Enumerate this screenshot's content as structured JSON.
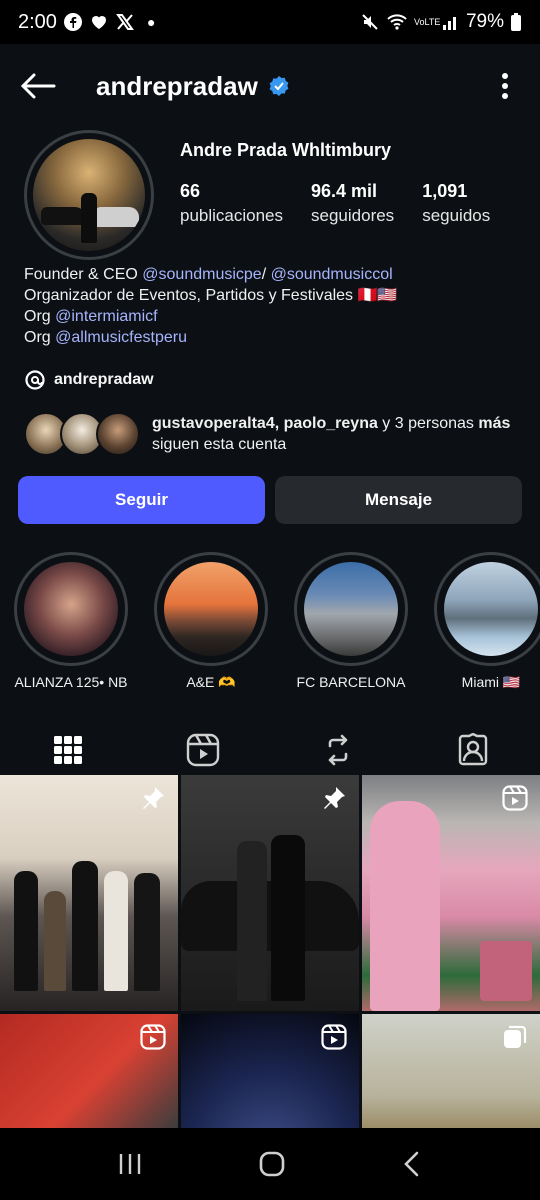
{
  "status_bar": {
    "time": "2:00",
    "battery": "79%",
    "network": "VoLTE"
  },
  "header": {
    "username": "andrepradaw",
    "verified": true
  },
  "profile": {
    "full_name": "Andre Prada Whltimbury",
    "stats": [
      {
        "value": "66",
        "label": "publicaciones"
      },
      {
        "value": "96.4 mil",
        "label": "seguidores"
      },
      {
        "value": "1,091",
        "label": "seguidos"
      }
    ],
    "bio": {
      "line1_prefix": "Founder & CEO ",
      "line1_mention1": "@soundmusicpe",
      "line1_sep": "/ ",
      "line1_mention2": "@soundmusiccol",
      "line2": "Organizador de Eventos, Partidos y Festivales 🇵🇪🇺🇸",
      "line3_prefix": "Org ",
      "line3_mention": "@intermiamicf",
      "line4_prefix": "Org ",
      "line4_mention": "@allmusicfestperu"
    },
    "threads_handle": "andrepradaw",
    "followed_by": {
      "names": "gustavoperalta4, paolo_reyna",
      "middle": " y 3 personas ",
      "more": "más",
      "suffix": " siguen esta cuenta"
    }
  },
  "actions": {
    "follow_label": "Seguir",
    "message_label": "Mensaje"
  },
  "highlights": [
    {
      "label": "ALIANZA 125• NB"
    },
    {
      "label": "A&E 🫶"
    },
    {
      "label": "FC BARCELONA"
    },
    {
      "label": "Miami 🇺🇸"
    }
  ],
  "tabs": [
    {
      "icon": "grid-icon",
      "active": true
    },
    {
      "icon": "reels-icon",
      "active": false
    },
    {
      "icon": "reposts-icon",
      "active": false
    },
    {
      "icon": "tagged-icon",
      "active": false
    }
  ],
  "grid_posts": [
    {
      "badge": "pin-icon"
    },
    {
      "badge": "pin-icon"
    },
    {
      "badge": "reel-icon"
    },
    {
      "badge": "reel-icon"
    },
    {
      "badge": "reel-icon"
    },
    {
      "badge": "carousel-icon"
    }
  ],
  "colors": {
    "accent": "#4f5bff",
    "mention": "#a5b4fc",
    "background": "#0c1014",
    "verified": "#3897f0"
  }
}
